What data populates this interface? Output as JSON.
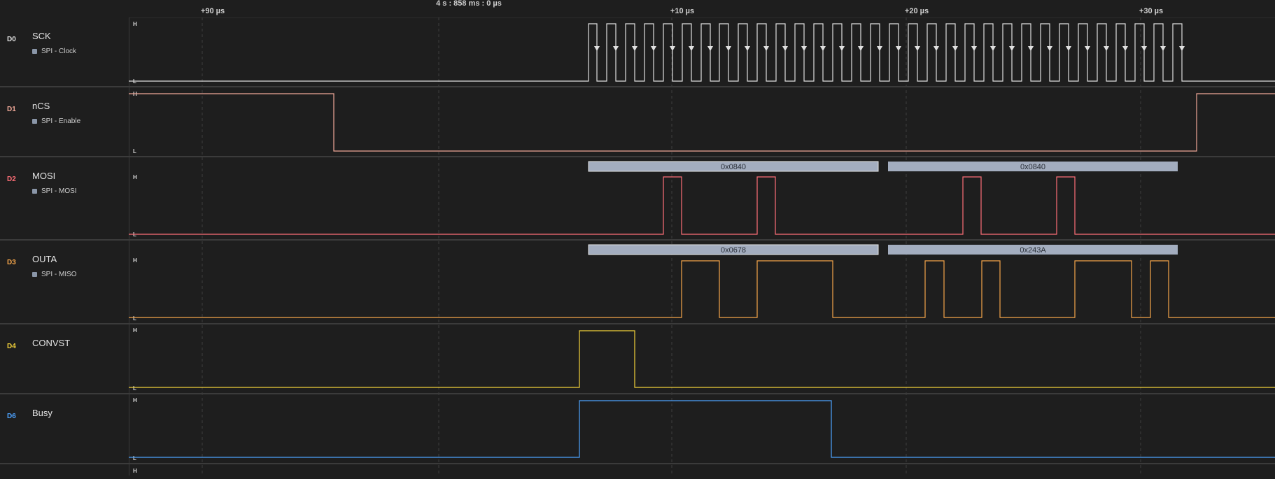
{
  "timebar": {
    "reference": "4 s : 858 ms : 0 µs",
    "markers": [
      "+90 µs",
      "+10 µs",
      "+20 µs",
      "+30 µs"
    ]
  },
  "level_labels": {
    "high": "H",
    "low": "L"
  },
  "channels": [
    {
      "id": "D0",
      "name": "SCK",
      "analyzer": "SPI - Clock",
      "color": "#e0e0e0"
    },
    {
      "id": "D1",
      "name": "nCS",
      "analyzer": "SPI - Enable",
      "color": "#f0a898"
    },
    {
      "id": "D2",
      "name": "MOSI",
      "analyzer": "SPI - MOSI",
      "color": "#ff6f77"
    },
    {
      "id": "D3",
      "name": "OUTA",
      "analyzer": "SPI - MISO",
      "color": "#f5a54a"
    },
    {
      "id": "D4",
      "name": "CONVST",
      "analyzer": "",
      "color": "#f2d13a"
    },
    {
      "id": "D6",
      "name": "Busy",
      "analyzer": "",
      "color": "#4da3ff"
    }
  ],
  "decodes": {
    "mosi": [
      "0x0840",
      "0x0840"
    ],
    "miso": [
      "0x0678",
      "0x243A"
    ]
  },
  "colors": {
    "background": "#1e1e1e",
    "grid": "#3f3f3f",
    "separator": "#3b3b3b",
    "decode_box": "#a3adbf",
    "decode_text": "#2a2f38"
  }
}
